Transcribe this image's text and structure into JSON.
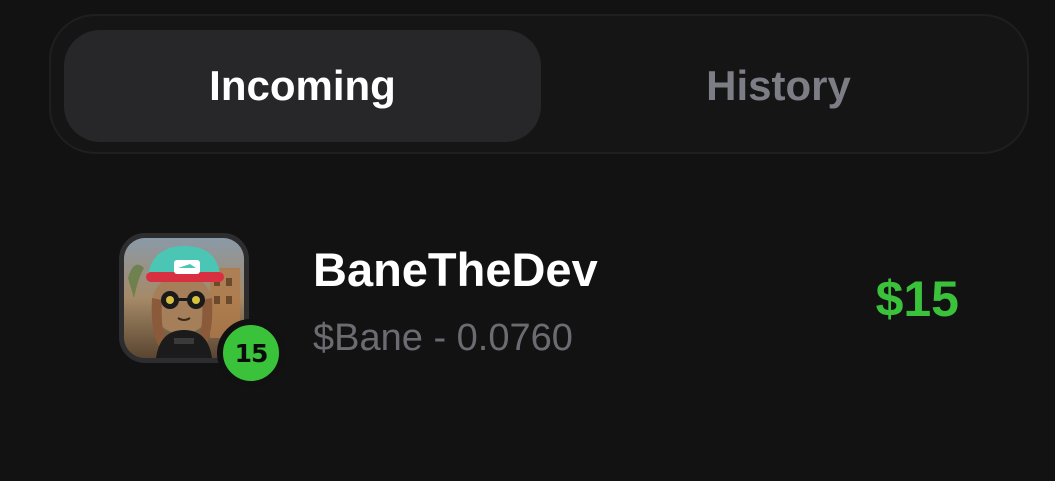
{
  "tabs": {
    "incoming_label": "Incoming",
    "history_label": "History",
    "active": "incoming"
  },
  "incoming": {
    "items": [
      {
        "name": "BaneTheDev",
        "token_info": "$Bane - 0.0760",
        "level": "15",
        "amount": "$15",
        "amount_color": "#3ac23a",
        "avatar_icon": "profile-avatar"
      }
    ]
  },
  "colors": {
    "background": "#121212",
    "active_tab": "#27272a",
    "inactive_tab_text": "#7d7d86",
    "accent_green": "#3ac23a",
    "secondary_text": "#6b6b72"
  }
}
